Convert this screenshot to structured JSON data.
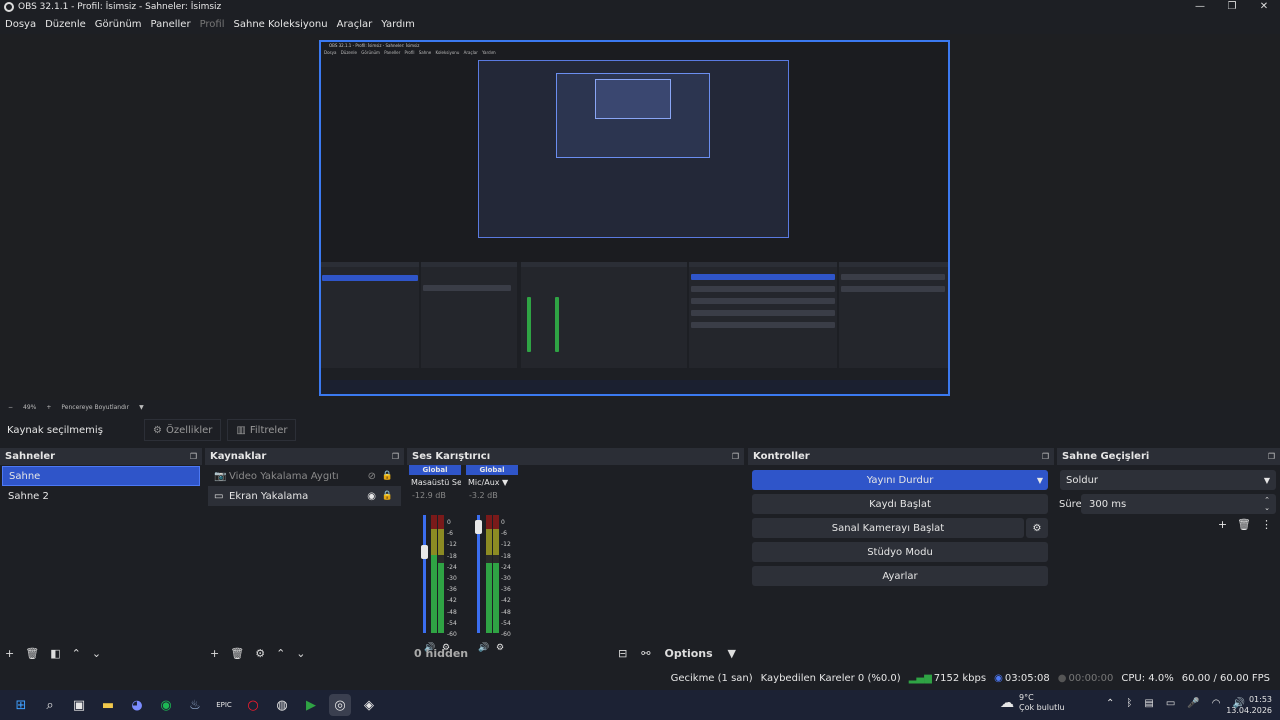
{
  "window": {
    "title": "OBS 32.1.1 - Profil: İsimsiz - Sahneler: İsimsiz",
    "minimize": "—",
    "maximize": "❐",
    "close": "✕"
  },
  "menu": [
    "Dosya",
    "Düzenle",
    "Görünüm",
    "Paneller",
    "Profil",
    "Sahne Koleksiyonu",
    "Araçlar",
    "Yardım"
  ],
  "preview": {
    "nested_title": "OBS 32.1.1 - Profil: İsimsiz - Sahneler: İsimsiz",
    "nested_menu": "Dosya Düzenle Görünüm Paneller Profil Sahne Koleksiyonu Araçlar Yardım"
  },
  "zoom": {
    "minus": "−",
    "level": "49%",
    "plus": "+",
    "mode": "Pencereye Boyutlandır"
  },
  "source_bar": {
    "status": "Kaynak seçilmemiş",
    "properties": "Özellikler",
    "filters": "Filtreler"
  },
  "scenes": {
    "title": "Sahneler",
    "items": [
      "Sahne",
      "Sahne 2"
    ]
  },
  "sources": {
    "title": "Kaynaklar",
    "items": [
      {
        "name": "Video Yakalama Aygıtı",
        "icon": "camera-icon"
      },
      {
        "name": "Ekran Yakalama",
        "icon": "monitor-icon"
      }
    ]
  },
  "mixer": {
    "title": "Ses Karıştırıcı",
    "channels": [
      {
        "global": "Global",
        "name": "Masaüstü Ses",
        "db": "-12.9 dB"
      },
      {
        "global": "Global",
        "name": "Mic/Aux",
        "db": "-3.2 dB"
      }
    ],
    "scale": [
      "0",
      "-6",
      "-12",
      "-18",
      "-24",
      "-30",
      "-36",
      "-42",
      "-48",
      "-54",
      "-60"
    ],
    "hidden": "0 hidden",
    "options": "Options"
  },
  "controls": {
    "title": "Kontroller",
    "stream": "Yayını Durdur",
    "record": "Kaydı Başlat",
    "virtualcam": "Sanal Kamerayı Başlat",
    "studio": "Stüdyo Modu",
    "settings": "Ayarlar"
  },
  "transitions": {
    "title": "Sahne Geçişleri",
    "type": "Soldur",
    "duration_label": "Süre",
    "duration": "300 ms"
  },
  "status": {
    "delay": "Gecikme (1 san)",
    "dropped": "Kaybedilen Kareler 0 (%0.0)",
    "kbps": "7152 kbps",
    "stream_time": "03:05:08",
    "rec_time": "00:00:00",
    "cpu": "CPU: 4.0%",
    "fps": "60.00 / 60.00 FPS"
  },
  "taskbar": {
    "temp": "9°C",
    "weather": "Çok bulutlu",
    "time": "01:53",
    "date": "13.04.2026"
  },
  "colors": {
    "accent": "#2f55c9",
    "background": "#1d1f24",
    "panel_header": "#2b2e36"
  }
}
